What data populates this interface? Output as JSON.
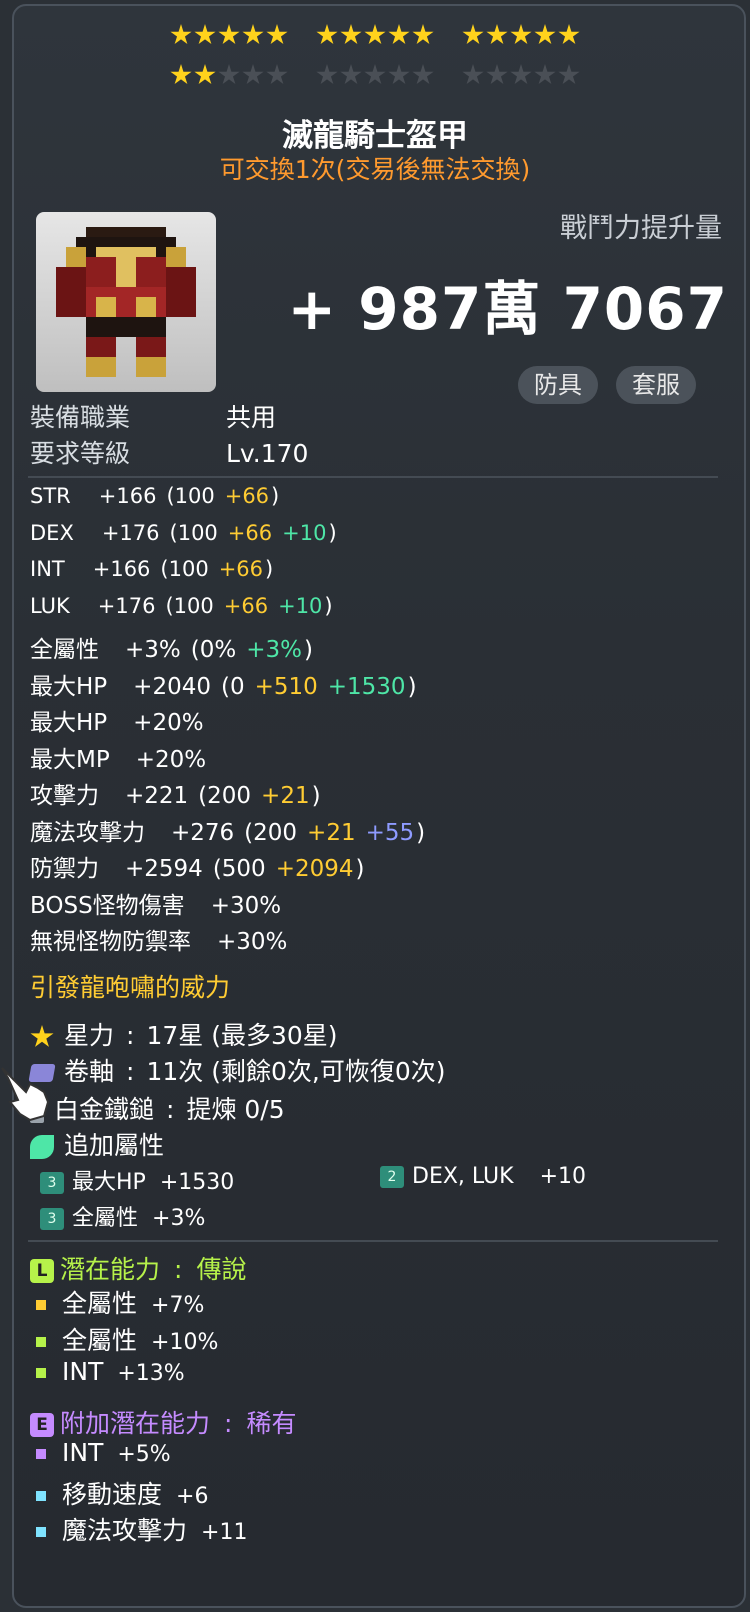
{
  "stars": {
    "filled": 17,
    "max": 30
  },
  "item": {
    "name": "滅龍騎士盔甲",
    "trade_note": "可交換1次(交易後無法交換)",
    "cp_label": "戰鬥力提升量",
    "cp_value": "+ 987萬 7067",
    "tags": [
      "防具",
      "套服"
    ]
  },
  "requirements": [
    {
      "label": "裝備職業",
      "value": "共用"
    },
    {
      "label": "要求等級",
      "value": "Lv.170"
    }
  ],
  "stats": [
    {
      "label": "STR",
      "total": "+166",
      "base": "(100",
      "parts": [
        {
          "text": "+66",
          "color": "gold"
        }
      ],
      "close": ")"
    },
    {
      "label": "DEX",
      "total": "+176",
      "base": "(100",
      "parts": [
        {
          "text": "+66",
          "color": "gold"
        },
        {
          "text": "+10",
          "color": "green"
        }
      ],
      "close": ")"
    },
    {
      "label": "INT",
      "total": "+166",
      "base": "(100",
      "parts": [
        {
          "text": "+66",
          "color": "gold"
        }
      ],
      "close": ")"
    },
    {
      "label": "LUK",
      "total": "+176",
      "base": "(100",
      "parts": [
        {
          "text": "+66",
          "color": "gold"
        },
        {
          "text": "+10",
          "color": "green"
        }
      ],
      "close": ")"
    },
    {
      "label": "全屬性",
      "total": "+3%",
      "base": "(0%",
      "parts": [
        {
          "text": "+3%",
          "color": "green"
        }
      ],
      "close": ")"
    },
    {
      "label": "最大HP",
      "total": "+2040",
      "base": "(0",
      "parts": [
        {
          "text": "+510",
          "color": "gold"
        },
        {
          "text": "+1530",
          "color": "green"
        }
      ],
      "close": ")"
    },
    {
      "label": "最大HP",
      "total": "+20%",
      "base": "",
      "parts": [],
      "close": ""
    },
    {
      "label": "最大MP",
      "total": "+20%",
      "base": "",
      "parts": [],
      "close": ""
    },
    {
      "label": "攻擊力",
      "total": "+221",
      "base": "(200",
      "parts": [
        {
          "text": "+21",
          "color": "gold"
        }
      ],
      "close": ")"
    },
    {
      "label": "魔法攻擊力",
      "total": "+276",
      "base": "(200",
      "parts": [
        {
          "text": "+21",
          "color": "gold"
        },
        {
          "text": "+55",
          "color": "blue"
        }
      ],
      "close": ")"
    },
    {
      "label": "防禦力",
      "total": "+2594",
      "base": "(500",
      "parts": [
        {
          "text": "+2094",
          "color": "gold"
        }
      ],
      "close": ")"
    },
    {
      "label": "BOSS怪物傷害",
      "total": "+30%",
      "base": "",
      "parts": [],
      "close": ""
    },
    {
      "label": "無視怪物防禦率",
      "total": "+30%",
      "base": "",
      "parts": [],
      "close": ""
    }
  ],
  "set_effect_text": "引發龍咆嘯的威力",
  "enhance": {
    "star_force": {
      "label": "星力",
      "value": "17星 (最多30星)"
    },
    "scroll": {
      "label": "卷軸",
      "value": "11次 (剩餘0次,可恢復0次)"
    },
    "hammer": {
      "label": "白金鐵鎚",
      "value": "提煉 0/5"
    },
    "flame_title": "追加屬性",
    "flame": [
      {
        "badge": "3",
        "label": "最大HP",
        "value": "+1530"
      },
      {
        "badge": "2",
        "label": "DEX, LUK",
        "value": "+10"
      },
      {
        "badge": "3",
        "label": "全屬性",
        "value": "+3%"
      }
    ]
  },
  "potential": {
    "badge": "L",
    "title": "潛在能力",
    "grade": "傳說",
    "lines": [
      {
        "label": "全屬性",
        "value": "+7%"
      },
      {
        "label": "全屬性",
        "value": "+10%"
      },
      {
        "label": "INT",
        "value": "+13%"
      }
    ]
  },
  "additional_potential": {
    "badge": "E",
    "title": "附加潛在能力",
    "grade": "稀有",
    "lines": [
      {
        "label": "INT",
        "value": "+5%"
      },
      {
        "label": "移動速度",
        "value": "+6"
      },
      {
        "label": "魔法攻擊力",
        "value": "+11"
      }
    ]
  },
  "colors": {
    "gold": "#ffcc33",
    "green": "#4ee6a7",
    "blue": "#8e9bff",
    "orange": "#ff9a2e",
    "legendary": "#b6f24a",
    "rare": "#c58bff",
    "star_on": "#ffd21c"
  }
}
